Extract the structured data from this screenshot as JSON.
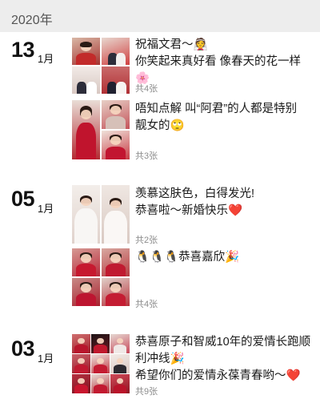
{
  "header": {
    "year": "2020年"
  },
  "groups": [
    {
      "day": "13",
      "month": "1月",
      "posts": [
        {
          "lines": [
            "祝福文君～👰",
            "你笑起来真好看 像春天的花一样🌸"
          ],
          "count": "共4张"
        },
        {
          "lines": [
            "唔知点解 叫“阿君”的人都是特别",
            "靓女的🙄"
          ],
          "count": "共3张"
        }
      ]
    },
    {
      "day": "05",
      "month": "1月",
      "posts": [
        {
          "lines": [
            "羡慕这肤色，白得发光!",
            "恭喜啦～新婚快乐❤️"
          ],
          "count": "共2张"
        },
        {
          "lines": [
            "🐧🐧🐧恭喜嘉欣🎉"
          ],
          "count": "共4张"
        }
      ]
    },
    {
      "day": "03",
      "month": "1月",
      "posts": [
        {
          "lines": [
            "恭喜原子和智威10年的爱情长跑顺",
            "利冲线🎉",
            "希望你们的爱情永葆青春哟～❤️"
          ],
          "count": "共9张"
        }
      ]
    }
  ],
  "colors": {
    "bridal_red": "#c8102e",
    "pale_ivory": "#efe6df",
    "count_gray": "#8b8b8b",
    "year_bar": "#ededed"
  }
}
